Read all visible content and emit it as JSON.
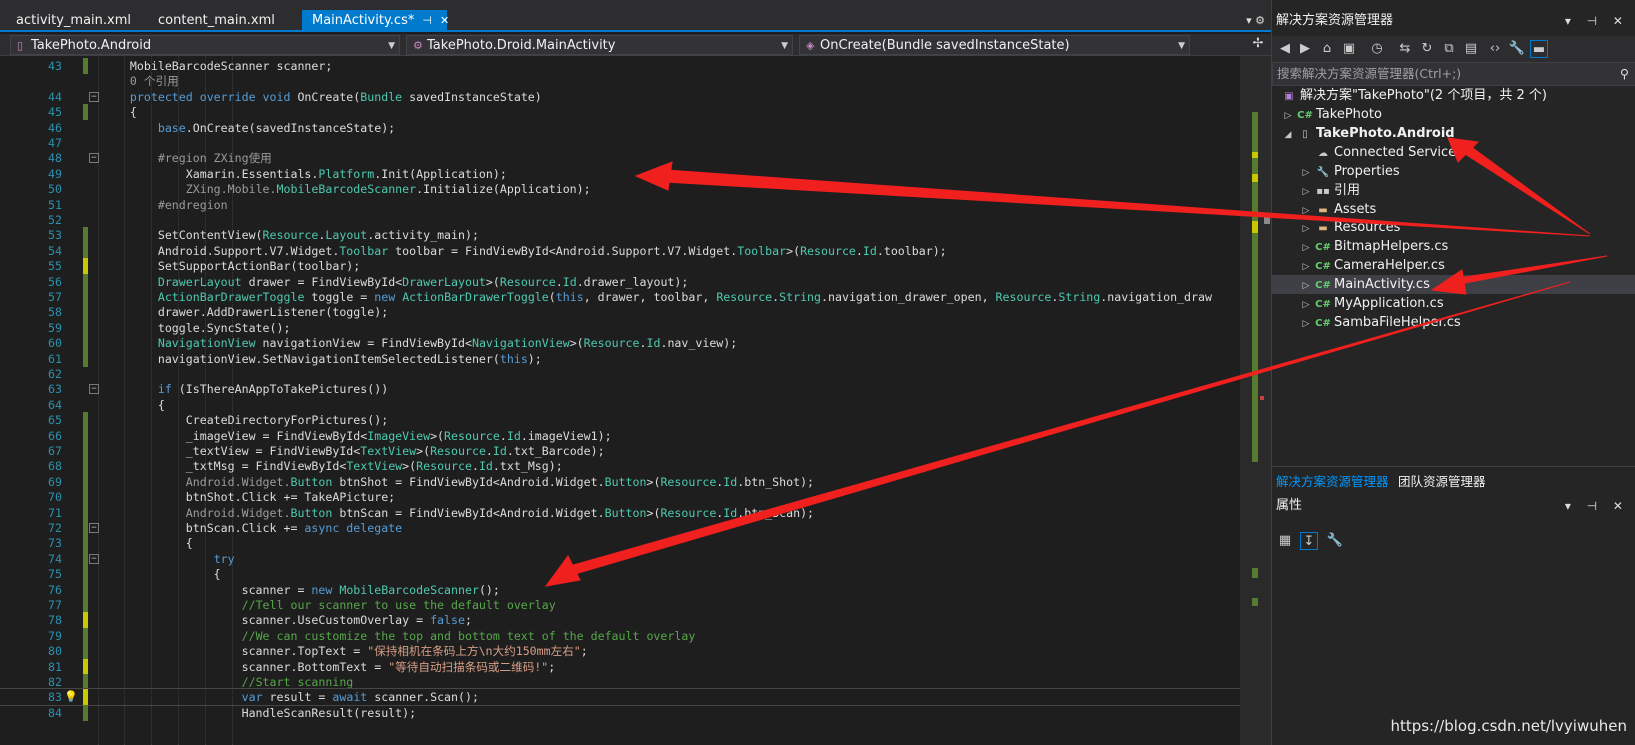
{
  "tabs": [
    {
      "label": "activity_main.xml",
      "active": false
    },
    {
      "label": "content_main.xml",
      "active": false
    },
    {
      "label": "MainActivity.cs*",
      "active": true
    }
  ],
  "tab_pin": "⊣",
  "tab_close": "✕",
  "nav": {
    "project": "TakePhoto.Android",
    "class": "TakePhoto.Droid.MainActivity",
    "member": "OnCreate(Bundle savedInstanceState)"
  },
  "code_lines": [
    {
      "n": "43",
      "html": "    MobileBarcodeScanner scanner;"
    },
    {
      "n": "",
      "html": "    <span class=\"gr\">0 个引用</span>"
    },
    {
      "n": "44",
      "html": "    <span class=\"kw\">protected override void</span> OnCreate(<span class=\"ty\">Bundle</span> savedInstanceState)"
    },
    {
      "n": "45",
      "html": "    {"
    },
    {
      "n": "46",
      "html": "        <span class=\"kw\">base</span>.OnCreate(savedInstanceState);"
    },
    {
      "n": "47",
      "html": ""
    },
    {
      "n": "48",
      "html": "        <span class=\"gr\">#region ZXing使用</span>"
    },
    {
      "n": "49",
      "html": "            Xamarin.Essentials.<span class=\"ty\">Platform</span>.Init(Application);"
    },
    {
      "n": "50",
      "html": "            <span class=\"gr\">ZXing.Mobile.</span><span class=\"ty\">MobileBarcodeScanner</span>.Initialize(Application);"
    },
    {
      "n": "51",
      "html": "        <span class=\"gr\">#endregion</span>"
    },
    {
      "n": "52",
      "html": ""
    },
    {
      "n": "53",
      "html": "        SetContentView(<span class=\"ty\">Resource</span>.<span class=\"ty\">Layout</span>.activity_main);"
    },
    {
      "n": "54",
      "html": "        Android.Support.V7.Widget.<span class=\"ty\">Toolbar</span> toolbar = FindViewById&lt;Android.Support.V7.Widget.<span class=\"ty\">Toolbar</span>&gt;(<span class=\"ty\">Resource</span>.<span class=\"ty\">Id</span>.toolbar);"
    },
    {
      "n": "55",
      "html": "        SetSupportActionBar(toolbar);"
    },
    {
      "n": "56",
      "html": "        <span class=\"ty\">DrawerLayout</span> drawer = FindViewById&lt;<span class=\"ty\">DrawerLayout</span>&gt;(<span class=\"ty\">Resource</span>.<span class=\"ty\">Id</span>.drawer_layout);"
    },
    {
      "n": "57",
      "html": "        <span class=\"ty\">ActionBarDrawerToggle</span> toggle = <span class=\"kw\">new</span> <span class=\"ty\">ActionBarDrawerToggle</span>(<span class=\"kw\">this</span>, drawer, toolbar, <span class=\"ty\">Resource</span>.<span class=\"ty\">String</span>.navigation_drawer_open, <span class=\"ty\">Resource</span>.<span class=\"ty\">String</span>.navigation_draw"
    },
    {
      "n": "58",
      "html": "        drawer.AddDrawerListener(toggle);"
    },
    {
      "n": "59",
      "html": "        toggle.SyncState();"
    },
    {
      "n": "60",
      "html": "        <span class=\"ty\">NavigationView</span> navigationView = FindViewById&lt;<span class=\"ty\">NavigationView</span>&gt;(<span class=\"ty\">Resource</span>.<span class=\"ty\">Id</span>.nav_view);"
    },
    {
      "n": "61",
      "html": "        navigationView.SetNavigationItemSelectedListener(<span class=\"kw\">this</span>);"
    },
    {
      "n": "62",
      "html": ""
    },
    {
      "n": "63",
      "html": "        <span class=\"kw\">if</span> (IsThereAnAppToTakePictures())"
    },
    {
      "n": "64",
      "html": "        {"
    },
    {
      "n": "65",
      "html": "            CreateDirectoryForPictures();"
    },
    {
      "n": "66",
      "html": "            _imageView = FindViewById&lt;<span class=\"ty\">ImageView</span>&gt;(<span class=\"ty\">Resource</span>.<span class=\"ty\">Id</span>.imageView1);"
    },
    {
      "n": "67",
      "html": "            _textView = FindViewById&lt;<span class=\"ty\">TextView</span>&gt;(<span class=\"ty\">Resource</span>.<span class=\"ty\">Id</span>.txt_Barcode);"
    },
    {
      "n": "68",
      "html": "            _txtMsg = FindViewById&lt;<span class=\"ty\">TextView</span>&gt;(<span class=\"ty\">Resource</span>.<span class=\"ty\">Id</span>.txt_Msg);"
    },
    {
      "n": "69",
      "html": "            <span class=\"gr\">Android.Widget.</span><span class=\"ty\">Button</span> btnShot = FindViewById&lt;Android.Widget.<span class=\"ty\">Button</span>&gt;(<span class=\"ty\">Resource</span>.<span class=\"ty\">Id</span>.btn_Shot);"
    },
    {
      "n": "70",
      "html": "            btnShot.Click += TakeAPicture;"
    },
    {
      "n": "71",
      "html": "            <span class=\"gr\">Android.Widget.</span><span class=\"ty\">Button</span> btnScan = FindViewById&lt;Android.Widget.<span class=\"ty\">Button</span>&gt;(<span class=\"ty\">Resource</span>.<span class=\"ty\">Id</span>.btn_Scan);"
    },
    {
      "n": "72",
      "html": "            btnScan.Click += <span class=\"kw\">async delegate</span>"
    },
    {
      "n": "73",
      "html": "            {"
    },
    {
      "n": "74",
      "html": "                <span class=\"kw\">try</span>"
    },
    {
      "n": "75",
      "html": "                {"
    },
    {
      "n": "76",
      "html": "                    scanner = <span class=\"kw\">new</span> <span class=\"ty\">MobileBarcodeScanner</span>();"
    },
    {
      "n": "77",
      "html": "                    <span class=\"cm\">//Tell our scanner to use the default overlay</span>"
    },
    {
      "n": "78",
      "html": "                    scanner.UseCustomOverlay = <span class=\"kw\">false</span>;"
    },
    {
      "n": "79",
      "html": "                    <span class=\"cm\">//We can customize the top and bottom text of the default overlay</span>"
    },
    {
      "n": "80",
      "html": "                    scanner.TopText = <span class=\"st\">\"保持相机在条码上方\\n大约150mm左右\"</span>;"
    },
    {
      "n": "81",
      "html": "                    scanner.BottomText = <span class=\"st\">\"等待自动扫描条码或二维码!\"</span>;"
    },
    {
      "n": "82",
      "html": "                    <span class=\"cm\">//Start scanning</span>"
    },
    {
      "n": "83",
      "html": "                    <span class=\"kw\">var</span> result = <span class=\"kw\">await</span> scanner.Scan();"
    },
    {
      "n": "84",
      "html": "                    HandleScanResult(result);"
    }
  ],
  "solution_explorer": {
    "title": "解决方案资源管理器",
    "search_placeholder": "搜索解决方案资源管理器(Ctrl+;)",
    "solution": "解决方案\"TakePhoto\"(2 个项目，共 2 个)",
    "items": [
      {
        "label": "TakePhoto",
        "icon": "C#",
        "depth": 1,
        "arrow": "▷"
      },
      {
        "label": "TakePhoto.Android",
        "icon": "▯",
        "depth": 1,
        "arrow": "◢",
        "bold": true
      },
      {
        "label": "Connected Services",
        "icon": "☁",
        "depth": 2,
        "arrow": ""
      },
      {
        "label": "Properties",
        "icon": "🔧",
        "depth": 2,
        "arrow": "▷"
      },
      {
        "label": "引用",
        "icon": "▪▪",
        "depth": 2,
        "arrow": "▷"
      },
      {
        "label": "Assets",
        "icon": "▬",
        "depth": 2,
        "arrow": "▷"
      },
      {
        "label": "Resources",
        "icon": "▬",
        "depth": 2,
        "arrow": "▷"
      },
      {
        "label": "BitmapHelpers.cs",
        "icon": "C#",
        "depth": 2,
        "arrow": "▷"
      },
      {
        "label": "CameraHelper.cs",
        "icon": "C#",
        "depth": 2,
        "arrow": "▷"
      },
      {
        "label": "MainActivity.cs",
        "icon": "C#",
        "depth": 2,
        "arrow": "▷",
        "selected": true
      },
      {
        "label": "MyApplication.cs",
        "icon": "C#",
        "depth": 2,
        "arrow": "▷"
      },
      {
        "label": "SambaFileHelper.cs",
        "icon": "C#",
        "depth": 2,
        "arrow": "▷"
      }
    ],
    "bottom_tabs": [
      "解决方案资源管理器",
      "团队资源管理器"
    ]
  },
  "properties": {
    "title": "属性"
  },
  "watermark": "https://blog.csdn.net/lvyiwuhen",
  "colors": {
    "accent": "#007acc",
    "annotation_arrow": "#f0201e"
  }
}
